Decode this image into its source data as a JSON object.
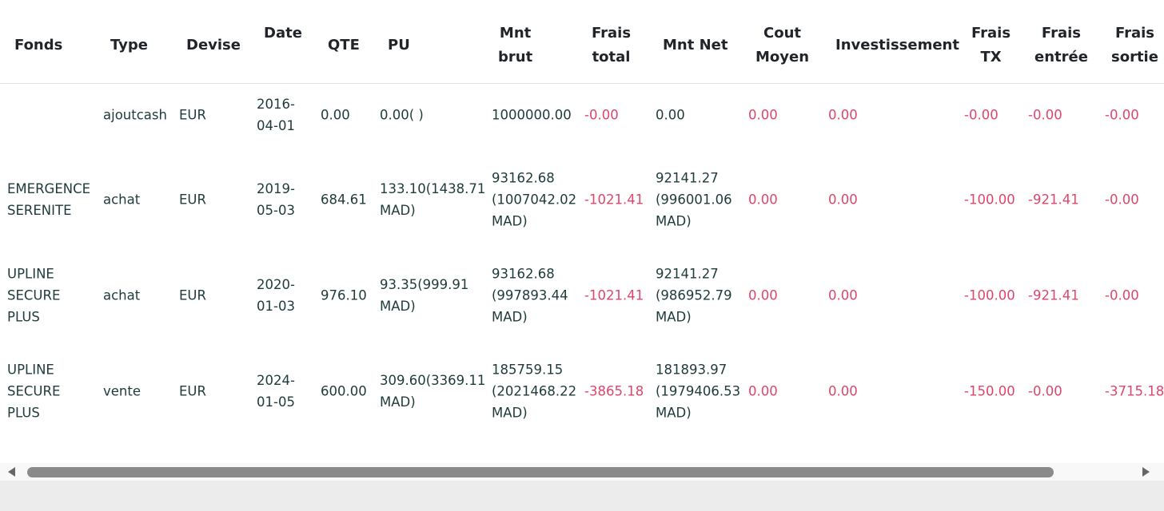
{
  "headers": {
    "fonds": "Fonds",
    "type": "Type",
    "devise": "Devise",
    "date": "Date",
    "qte": "QTE",
    "pu": "PU",
    "mnt_brut": "Mnt\nbrut",
    "frais_total": "Frais\ntotal",
    "mnt_net": "Mnt Net",
    "cout_moyen": "Cout\nMoyen",
    "investissement": "Investissement",
    "frais_tx": "Frais\nTX",
    "frais_entree": "Frais\nentrée",
    "frais_sortie": "Frais\nsortie"
  },
  "rows": [
    {
      "fonds": "",
      "type": "ajoutcash",
      "devise": "EUR",
      "date": "2016-\n04-01",
      "qte": "0.00",
      "pu": "0.00( )",
      "mnt_brut": "1000000.00",
      "frais_total": "-0.00",
      "mnt_net": "0.00",
      "cout_moyen": "0.00",
      "investissement": "0.00",
      "frais_tx": "-0.00",
      "frais_entree": "-0.00",
      "frais_sortie": "-0.00"
    },
    {
      "fonds": "EMERGENCE\nSERENITE",
      "type": "achat",
      "devise": "EUR",
      "date": "2019-\n05-03",
      "qte": "684.61",
      "pu": "133.10(1438.71\nMAD)",
      "mnt_brut": "93162.68\n(1007042.02\nMAD)",
      "frais_total": "-1021.41",
      "mnt_net": "92141.27\n(996001.06\nMAD)",
      "cout_moyen": "0.00",
      "investissement": "0.00",
      "frais_tx": "-100.00",
      "frais_entree": "-921.41",
      "frais_sortie": "-0.00"
    },
    {
      "fonds": "UPLINE\nSECURE\nPLUS",
      "type": "achat",
      "devise": "EUR",
      "date": "2020-\n01-03",
      "qte": "976.10",
      "pu": "93.35(999.91\nMAD)",
      "mnt_brut": "93162.68\n(997893.44\nMAD)",
      "frais_total": "-1021.41",
      "mnt_net": "92141.27\n(986952.79\nMAD)",
      "cout_moyen": "0.00",
      "investissement": "0.00",
      "frais_tx": "-100.00",
      "frais_entree": "-921.41",
      "frais_sortie": "-0.00"
    },
    {
      "fonds": "UPLINE\nSECURE\nPLUS",
      "type": "vente",
      "devise": "EUR",
      "date": "2024-\n01-05",
      "qte": "600.00",
      "pu": "309.60(3369.11\nMAD)",
      "mnt_brut": "185759.15\n(2021468.22\nMAD)",
      "frais_total": "-3865.18",
      "mnt_net": "181893.97\n(1979406.53\nMAD)",
      "cout_moyen": "0.00",
      "investissement": "0.00",
      "frais_tx": "-150.00",
      "frais_entree": "-0.00",
      "frais_sortie": "-3715.18"
    }
  ],
  "colors": {
    "negative": "#e0456b",
    "text": "#1f3a3a",
    "header_text": "#212529",
    "border": "#dee2e6"
  },
  "scrollbar": {
    "left_arrow_icon": "arrow-left-icon",
    "right_arrow_icon": "arrow-right-icon"
  }
}
